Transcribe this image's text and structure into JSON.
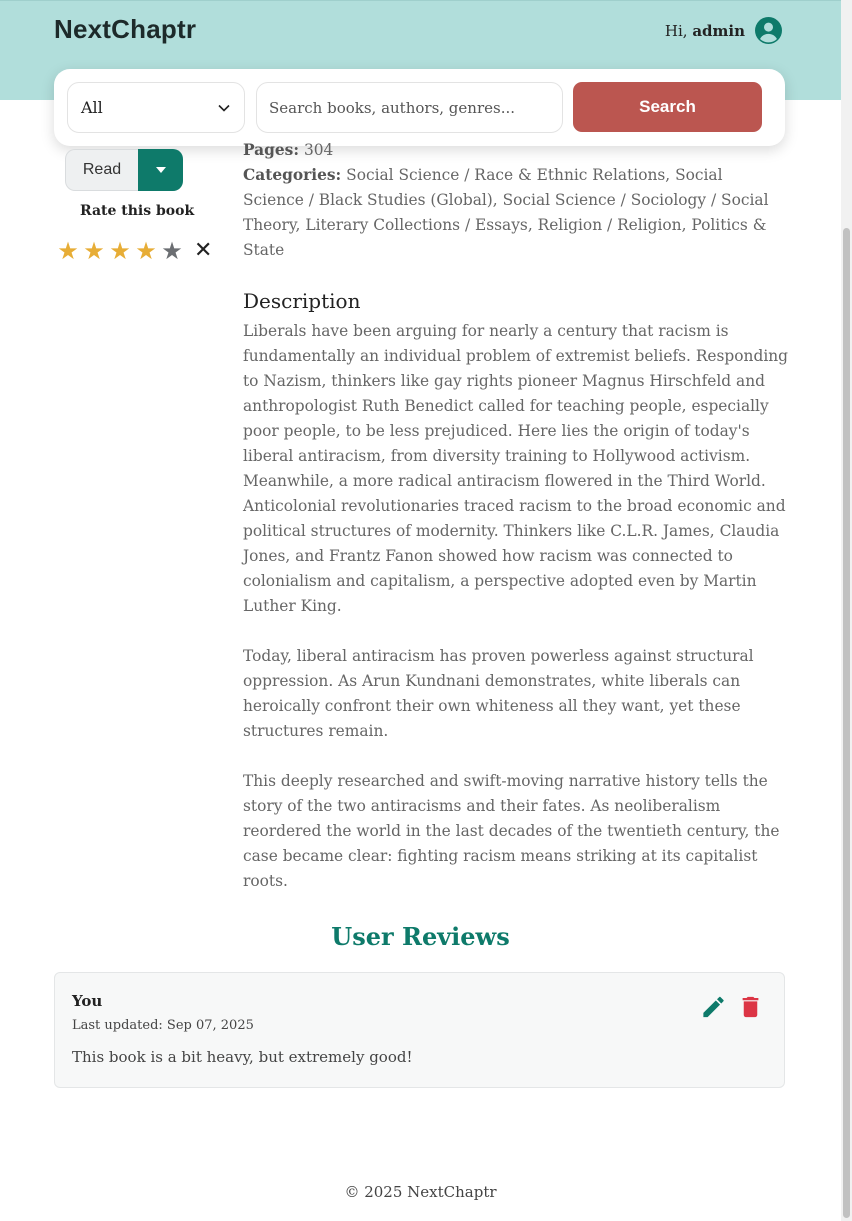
{
  "header": {
    "brand": "NextChaptr",
    "greeting": "Hi,",
    "username": "admin",
    "avatar_icon": "user-circle-icon"
  },
  "search": {
    "filter_selected": "All",
    "placeholder": "Search books, authors, genres...",
    "button_label": "Search"
  },
  "book_actions": {
    "status_label": "Read",
    "rate_label": "Rate this book",
    "rating": 4,
    "max_rating": 5
  },
  "details": {
    "pages_label": "Pages:",
    "pages_value": "304",
    "categories_label": "Categories:",
    "categories_value": "Social Science / Race & Ethnic Relations, Social Science / Black Studies (Global), Social Science / Sociology / Social Theory, Literary Collections / Essays, Religion / Religion, Politics & State"
  },
  "description": {
    "title": "Description",
    "paragraphs": [
      "Liberals have been arguing for nearly a century that racism is fundamentally an individual problem of extremist beliefs. Responding to Nazism, thinkers like gay rights pioneer Magnus Hirschfeld and anthropologist Ruth Benedict called for teaching people, especially poor people, to be less prejudiced. Here lies the origin of today's liberal antiracism, from diversity training to Hollywood activism. Meanwhile, a more radical antiracism flowered in the Third World. Anticolonial revolutionaries traced racism to the broad economic and political structures of modernity. Thinkers like C.L.R. James, Claudia Jones, and Frantz Fanon showed how racism was connected to colonialism and capitalism, a perspective adopted even by Martin Luther King.",
      "Today, liberal antiracism has proven powerless against structural oppression. As Arun Kundnani demonstrates, white liberals can heroically confront their own whiteness all they want, yet these structures remain.",
      "This deeply researched and swift-moving narrative history tells the story of the two antiracisms and their fates. As neoliberalism reordered the world in the last decades of the twentieth century, the case became clear: fighting racism means striking at its capitalist roots."
    ]
  },
  "reviews": {
    "title": "User Reviews",
    "items": [
      {
        "author": "You",
        "updated": "Last updated: Sep 07, 2025",
        "text": "This book is a bit heavy, but extremely good!"
      }
    ]
  },
  "footer": {
    "text": "© 2025 NextChaptr"
  },
  "colors": {
    "header_bg": "#b1dedb",
    "accent_teal": "#0e7a6a",
    "search_button": "#bb5650",
    "star_filled": "#e7ad36",
    "delete_red": "#dc3545"
  }
}
